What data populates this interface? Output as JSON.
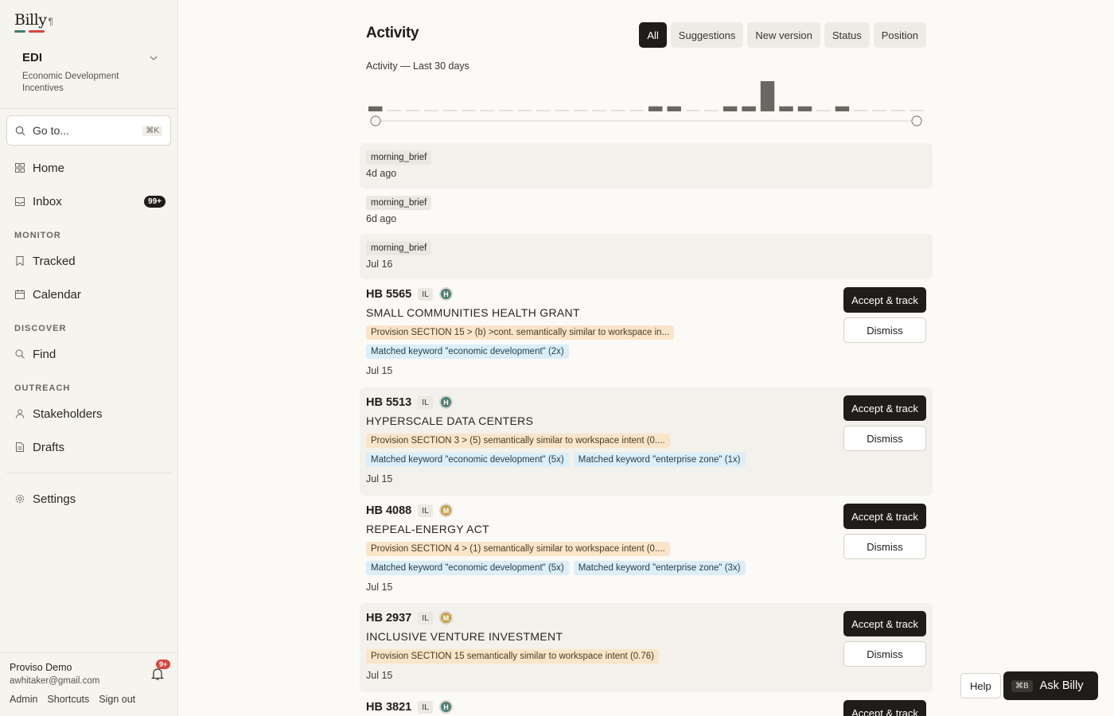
{
  "app": {
    "name": "Billy",
    "mark": "¶"
  },
  "workspace": {
    "name": "EDI",
    "description_line1": "Economic Development",
    "description_line2": "Incentives"
  },
  "search": {
    "placeholder": "Go to...",
    "shortcut": "⌘K"
  },
  "nav": {
    "home": "Home",
    "inbox": "Inbox",
    "inbox_badge": "99+",
    "monitor_label": "MONITOR",
    "tracked": "Tracked",
    "calendar": "Calendar",
    "discover_label": "DISCOVER",
    "find": "Find",
    "outreach_label": "OUTREACH",
    "stakeholders": "Stakeholders",
    "drafts": "Drafts",
    "settings": "Settings"
  },
  "user": {
    "name": "Proviso Demo",
    "email": "awhitaker@gmail.com",
    "notif_badge": "9+",
    "links": {
      "admin": "Admin",
      "shortcuts": "Shortcuts",
      "signout": "Sign out"
    }
  },
  "page": {
    "title": "Activity"
  },
  "filters": [
    "All",
    "Suggestions",
    "New version",
    "Status",
    "Position"
  ],
  "chart_data": {
    "type": "bar",
    "title": "Activity — Last 30 days",
    "values": [
      1,
      0,
      0,
      0,
      0,
      0,
      0,
      0,
      0,
      0,
      0,
      0,
      0,
      0,
      0,
      1,
      1,
      0,
      0,
      1,
      1,
      6,
      1,
      1,
      0,
      1,
      0,
      0,
      0,
      0
    ],
    "ymax": 6,
    "range_handles": [
      "start",
      "end"
    ]
  },
  "feed": {
    "briefs": [
      {
        "tag": "morning_brief",
        "date": "4d ago"
      },
      {
        "tag": "morning_brief",
        "date": "6d ago"
      },
      {
        "tag": "morning_brief",
        "date": "Jul 16"
      }
    ],
    "bills": [
      {
        "number": "HB 5565",
        "state": "IL",
        "priority": "H",
        "title": "SMALL COMMUNITIES HEALTH GRANT",
        "provision": "Provision SECTION 15 > (b) >cont. semantically similar to workspace in...",
        "keywords": [
          "Matched keyword \"economic development\" (2x)"
        ],
        "date": "Jul 15"
      },
      {
        "number": "HB 5513",
        "state": "IL",
        "priority": "H",
        "title": "HYPERSCALE DATA CENTERS",
        "provision": "Provision SECTION 3 > (5) semantically similar to workspace intent (0....",
        "keywords": [
          "Matched keyword \"economic development\" (5x)",
          "Matched keyword \"enterprise zone\" (1x)"
        ],
        "date": "Jul 15"
      },
      {
        "number": "HB 4088",
        "state": "IL",
        "priority": "M",
        "title": "REPEAL-ENERGY ACT",
        "provision": "Provision SECTION 4 > (1) semantically similar to workspace intent (0....",
        "keywords": [
          "Matched keyword \"economic development\" (5x)",
          "Matched keyword \"enterprise zone\" (3x)"
        ],
        "date": "Jul 15"
      },
      {
        "number": "HB 2937",
        "state": "IL",
        "priority": "M",
        "title": "INCLUSIVE VENTURE INVESTMENT",
        "provision": "Provision SECTION 15 semantically similar to workspace intent (0.76)",
        "keywords": [],
        "date": "Jul 15"
      },
      {
        "number": "HB 3821",
        "state": "IL",
        "priority": "H"
      }
    ],
    "accept_label": "Accept & track",
    "dismiss_label": "Dismiss"
  },
  "floating": {
    "help": "Help",
    "ask_shortcut": "⌘B",
    "ask": "Ask Billy"
  }
}
